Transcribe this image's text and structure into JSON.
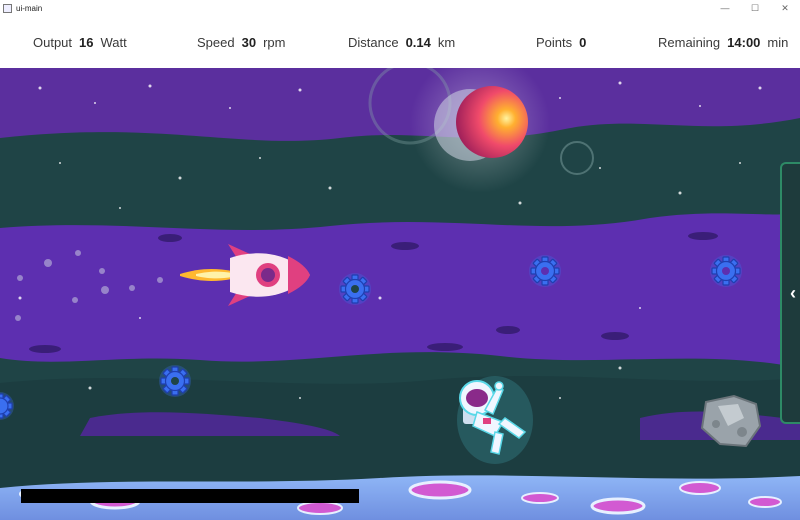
{
  "window": {
    "title": "ui-main",
    "minimize": "—",
    "maximize": "☐",
    "close": "✕"
  },
  "stats": [
    {
      "key": "output",
      "label": "Output",
      "value": "16",
      "unit": "Watt"
    },
    {
      "key": "speed",
      "label": "Speed",
      "value": "30",
      "unit": "rpm"
    },
    {
      "key": "distance",
      "label": "Distance",
      "value": "0.14",
      "unit": "km"
    },
    {
      "key": "points",
      "label": "Points",
      "value": "0",
      "unit": ""
    },
    {
      "key": "remaining",
      "label": "Remaining",
      "value": "14:00",
      "unit": "min"
    }
  ],
  "game": {
    "scene": "space",
    "collectibles": [
      "gear-icon",
      "gear-icon",
      "gear-icon",
      "gear-icon",
      "gear-icon"
    ],
    "progress": 0
  },
  "side_panel": {
    "icon": "chevron-left-icon",
    "glyph": "‹"
  },
  "colors": {
    "sky": "#1f4446",
    "band": "#5a2ea6",
    "moon_surface": "#7fa8f0",
    "crater": "#d25ad2",
    "gear": "#3a6ff0",
    "planet": "#f04a6a",
    "panel": "#1e3b3c",
    "accent": "#2e8a66"
  }
}
